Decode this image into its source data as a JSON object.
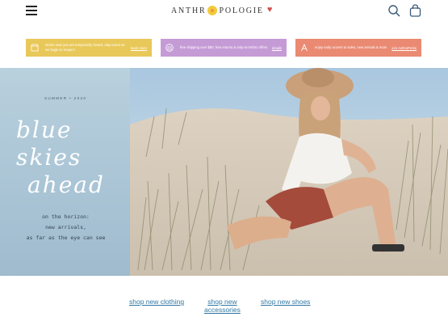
{
  "header": {
    "logo_left": "ANTHR",
    "logo_right": "POLOGIE",
    "menu_icon": "hamburger-icon",
    "search_icon": "search-icon",
    "bag_icon": "shopping-bag-icon"
  },
  "promos": [
    {
      "text": "stores near you are temporarily closed. stay tuned as we begin to reopen!",
      "link": "learn more",
      "icon": "store-icon",
      "color": "#e9c85a"
    },
    {
      "text": "free shipping over $50, free returns & only-at-Anthro offers",
      "link": "details",
      "icon": "gift-icon",
      "color": "#c59bd6"
    },
    {
      "text": "enjoy early access to sales, new arrivals & more",
      "link": "join AnthroPerks",
      "icon": "anthro-a-icon",
      "color": "#ea8a73"
    }
  ],
  "hero": {
    "season": "SUMMER  •  2020",
    "title_line1": "blue skies",
    "title_line2": "ahead",
    "tagline": [
      "on the horizon:",
      "new arrivals,",
      "as far as the eye can see"
    ]
  },
  "shop_links": [
    {
      "label": "shop new clothing"
    },
    {
      "label_l1": "shop new",
      "label_l2": "accessories"
    },
    {
      "label": "shop new shoes"
    }
  ]
}
